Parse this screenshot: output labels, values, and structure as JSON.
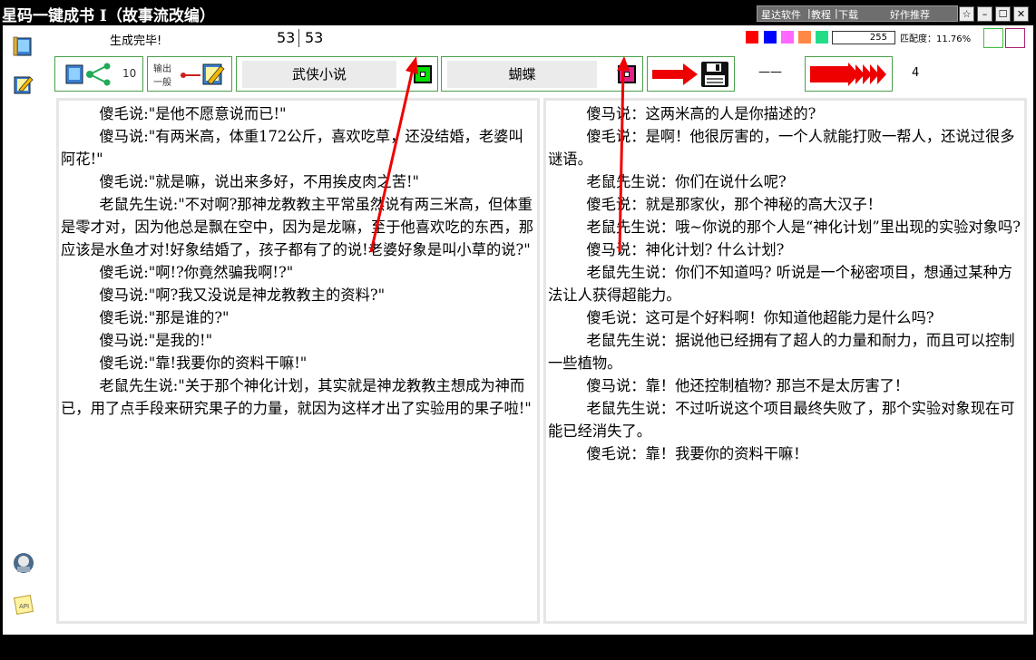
{
  "window": {
    "title": "星码一键成书 I（故事流改编）",
    "links": {
      "software": "星达软件",
      "sep1": "|",
      "tutorial": "教程",
      "sep2": "|",
      "download": "下载",
      "recommend": "好作推荐"
    },
    "controls": {
      "star": "☆",
      "minimize": "–",
      "maximize": "☐",
      "close": "✕"
    }
  },
  "status": {
    "message": "生成完毕!",
    "count_current": "53",
    "count_total": "53",
    "number_value": "255",
    "match_label": "匹配度：11.76%"
  },
  "colors": {
    "swatches": [
      "#ff0000",
      "#0000ff",
      "#ff66ff",
      "#ff8844",
      "#22dd88"
    ],
    "outline_boxes": [
      "#44bb44",
      "#aa2277"
    ],
    "accent_green": "#00dd00",
    "accent_pink": "#dd2288",
    "arrow_red": "#ee0000"
  },
  "toolbar": {
    "share_count": "10",
    "output_line1": "输出",
    "output_line2": "一般",
    "style_dropdown": "武侠小说",
    "target_dropdown": "蝴蝶",
    "dash_label": "——",
    "page_number": "4"
  },
  "icons": {
    "sidebar": [
      "book-icon",
      "notebook-edit-icon",
      "character-avatar-icon",
      "api-note-icon"
    ],
    "toolbar": [
      "share-icon",
      "output-edit-icon",
      "green-dot-icon",
      "pink-dot-icon",
      "right-arrow-icon",
      "save-disk-icon",
      "forward-arrows-icon"
    ]
  },
  "left_panel": {
    "paragraphs": [
      "傻毛说:\"是他不愿意说而已!\"",
      "傻马说:\"有两米高，体重172公斤，喜欢吃草，还没结婚，老婆叫阿花!\"",
      "傻毛说:\"就是嘛，说出来多好，不用挨皮肉之苦!\"",
      "老鼠先生说:\"不对啊?那神龙教教主平常虽然说有两三米高，但体重是零才对，因为他总是飘在空中，因为是龙嘛，至于他喜欢吃的东西，那应该是水鱼才对!好象结婚了，孩子都有了的说!老婆好象是叫小草的说?\"",
      "傻毛说:\"啊!?你竟然骗我啊!?\"",
      "傻马说:\"啊?我又没说是神龙教教主的资料?\"",
      "傻毛说:\"那是谁的?\"",
      "傻马说:\"是我的!\"",
      "傻毛说:\"靠!我要你的资料干嘛!\"",
      "老鼠先生说:\"关于那个神化计划，其实就是神龙教教主想成为神而已，用了点手段来研究果子的力量，就因为这样才出了实验用的果子啦!\""
    ]
  },
  "right_panel": {
    "paragraphs": [
      "傻马说：这两米高的人是你描述的?",
      "傻毛说：是啊！他很厉害的，一个人就能打败一帮人，还说过很多谜语。",
      "老鼠先生说：你们在说什么呢?",
      "傻毛说：就是那家伙，那个神秘的高大汉子！",
      "老鼠先生说：哦~你说的那个人是“神化计划”里出现的实验对象吗?",
      "傻马说：神化计划? 什么计划?",
      "老鼠先生说：你们不知道吗? 听说是一个秘密项目，想通过某种方法让人获得超能力。",
      "傻毛说：这可是个好料啊！你知道他超能力是什么吗?",
      "老鼠先生说：据说他已经拥有了超人的力量和耐力，而且可以控制一些植物。",
      "傻马说：靠！他还控制植物? 那岂不是太厉害了！",
      "老鼠先生说：不过听说这个项目最终失败了，那个实验对象现在可能已经消失了。",
      "傻毛说：靠！我要你的资料干嘛！"
    ]
  }
}
